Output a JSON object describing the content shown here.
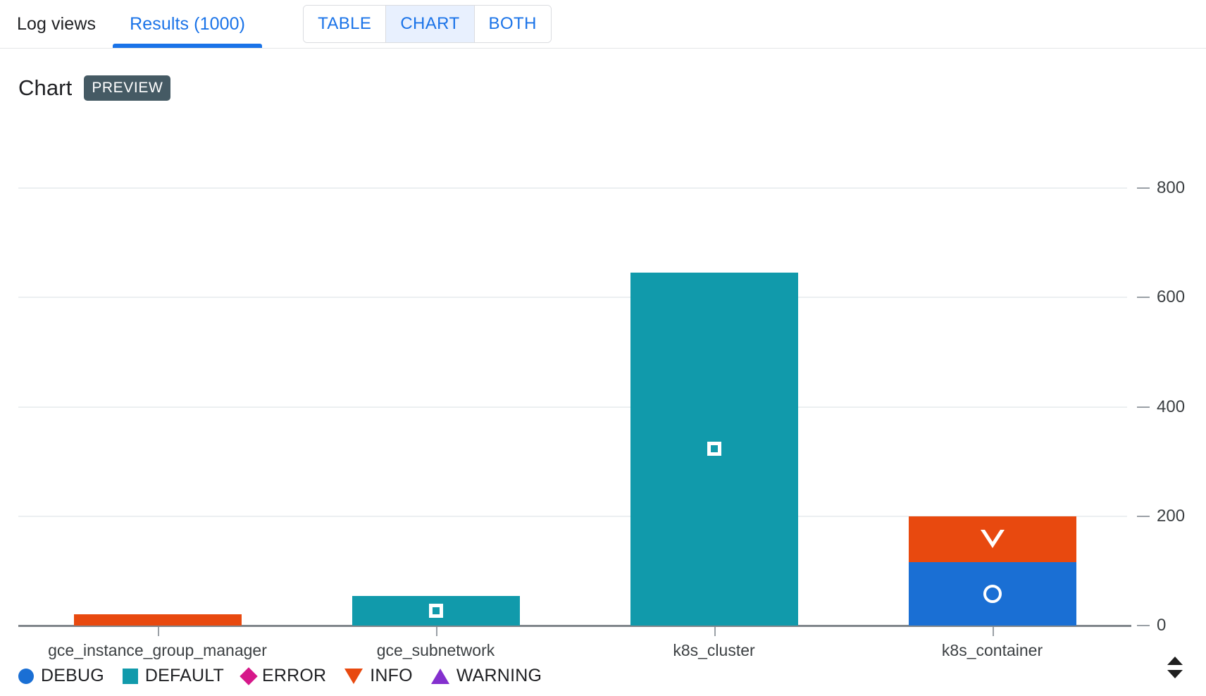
{
  "tabs": {
    "log_views": "Log views",
    "results": "Results (1000)"
  },
  "view_toggle": {
    "options": [
      "TABLE",
      "CHART",
      "BOTH"
    ],
    "selected": "CHART"
  },
  "panel": {
    "title": "Chart",
    "badge": "PREVIEW"
  },
  "expand_control": {
    "icon": "chevron-up-down-icon"
  },
  "chart_data": {
    "type": "bar",
    "stacked": true,
    "title": "Chart",
    "xlabel": "",
    "ylabel": "",
    "ylim": [
      0,
      880
    ],
    "yticks": [
      0,
      200,
      400,
      600,
      800
    ],
    "ytick_labels": [
      "0",
      "200",
      "400",
      "600",
      "800"
    ],
    "grid": true,
    "axis_position": "right",
    "legend_position": "bottom-left",
    "categories": [
      "gce_instance_group_manager",
      "gce_subnetwork",
      "k8s_cluster",
      "k8s_container"
    ],
    "series": [
      {
        "name": "DEBUG",
        "color": "#1a6fd4",
        "marker": "circle",
        "values": [
          0,
          0,
          0,
          116
        ]
      },
      {
        "name": "DEFAULT",
        "color": "#119aab",
        "marker": "square",
        "values": [
          0,
          54,
          646,
          0
        ]
      },
      {
        "name": "ERROR",
        "color": "#d6188a",
        "marker": "diamond",
        "values": [
          0,
          0,
          0,
          0
        ]
      },
      {
        "name": "INFO",
        "color": "#e8490f",
        "marker": "triangle-down",
        "values": [
          21,
          0,
          0,
          84
        ]
      },
      {
        "name": "WARNING",
        "color": "#8430ce",
        "marker": "triangle-up",
        "values": [
          0,
          0,
          0,
          0
        ]
      }
    ]
  }
}
